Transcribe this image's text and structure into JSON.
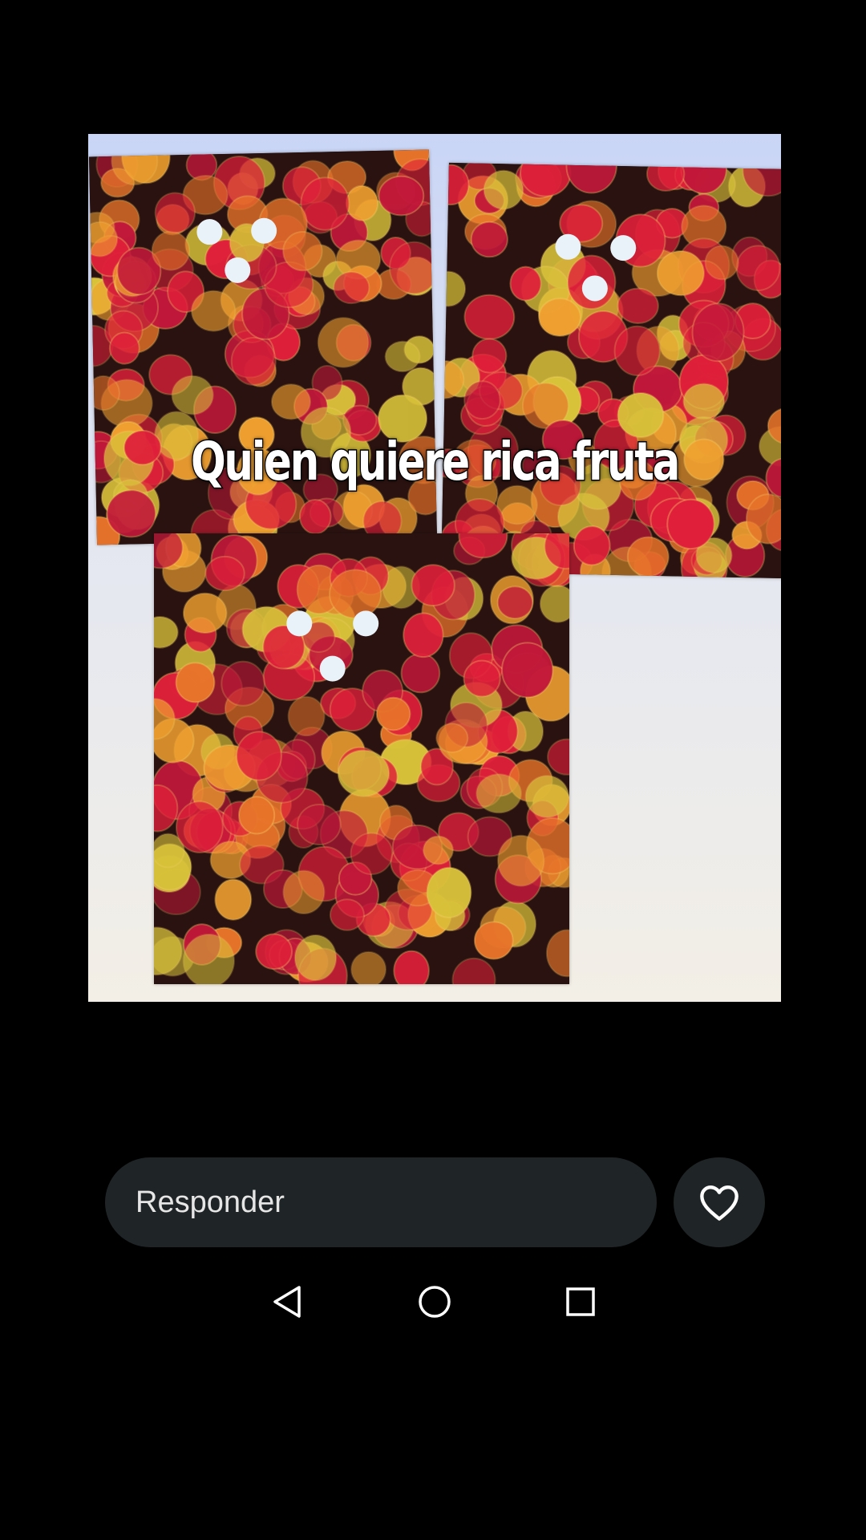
{
  "story": {
    "caption": "Quien quiere rica fruta",
    "colors": {
      "backdrop_top": "#c9d5f6",
      "backdrop_bottom": "#f3efe6",
      "fruit_red": "#e0203a",
      "fruit_orange": "#e8742a",
      "fruit_yellow": "#d8c23a"
    }
  },
  "reply": {
    "placeholder": "Responder"
  },
  "like": {
    "icon": "heart-outline-icon"
  },
  "nav": {
    "back_icon": "triangle-back-icon",
    "home_icon": "circle-home-icon",
    "recents_icon": "square-recents-icon"
  }
}
